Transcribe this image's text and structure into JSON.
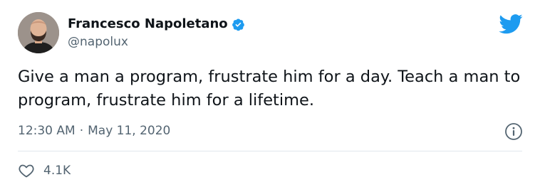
{
  "author": {
    "display_name": "Francesco Napoletano",
    "handle": "@napolux",
    "avatar_icon": "user-avatar-photo",
    "verified": true
  },
  "tweet": {
    "text": "Give a man a program, frustrate him for a day. Teach a man to program, frustrate him for a lifetime.",
    "time": "12:30 AM",
    "separator": "·",
    "date": "May 11, 2020"
  },
  "engagement": {
    "likes": "4.1K"
  },
  "icons": {
    "brand": "twitter-bird-icon",
    "info": "info-icon",
    "like": "heart-icon",
    "verified": "verified-badge-icon"
  },
  "colors": {
    "brand_blue": "#1d9bf0",
    "text_primary": "#0f1419",
    "text_secondary": "#536471",
    "divider": "#e1e8ed"
  }
}
